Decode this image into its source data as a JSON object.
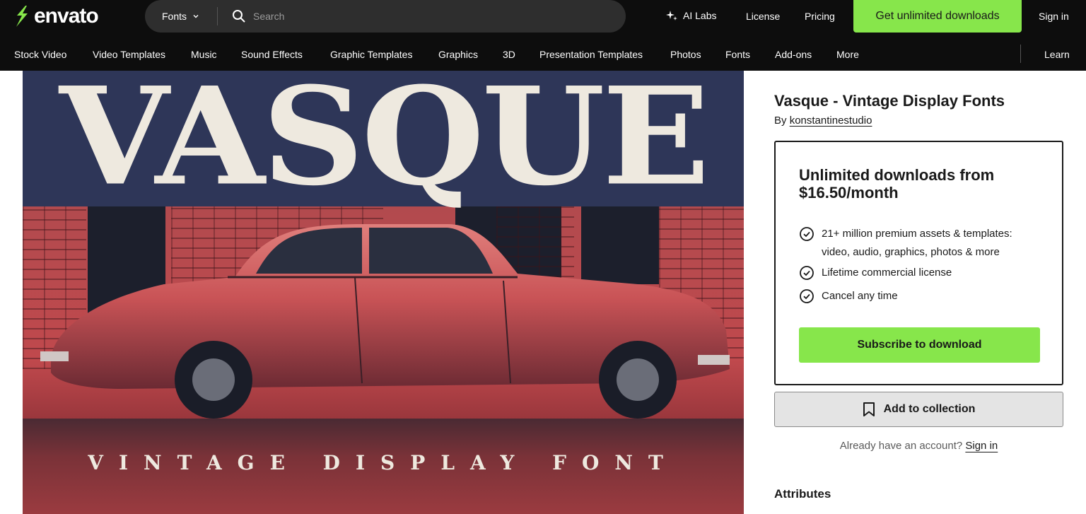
{
  "brand": {
    "name": "envato",
    "accent": "#87e64b"
  },
  "header": {
    "search": {
      "category": "Fonts",
      "placeholder": "Search"
    },
    "ai_labs": "AI Labs",
    "license": "License",
    "pricing": "Pricing",
    "cta": "Get unlimited downloads",
    "sign_in": "Sign in"
  },
  "categories": [
    "Stock Video",
    "Video Templates",
    "Music",
    "Sound Effects",
    "Graphic Templates",
    "Graphics",
    "3D",
    "Presentation Templates",
    "Photos",
    "Fonts",
    "Add-ons",
    "More"
  ],
  "learn": "Learn",
  "preview": {
    "headline": "VASQUE",
    "subtitle": "VINTAGE DISPLAY FONT"
  },
  "item": {
    "title": "Vasque - Vintage Display Fonts",
    "by_label": "By",
    "author": "konstantinestudio"
  },
  "pricing_card": {
    "heading": "Unlimited downloads from $16.50/month",
    "features": [
      "21+ million premium assets & templates: video, audio, graphics, photos & more",
      "Lifetime commercial license",
      "Cancel any time"
    ],
    "subscribe": "Subscribe to download"
  },
  "collection_button": "Add to collection",
  "account": {
    "text": "Already have an account?",
    "link": "Sign in"
  },
  "attributes_heading": "Attributes"
}
